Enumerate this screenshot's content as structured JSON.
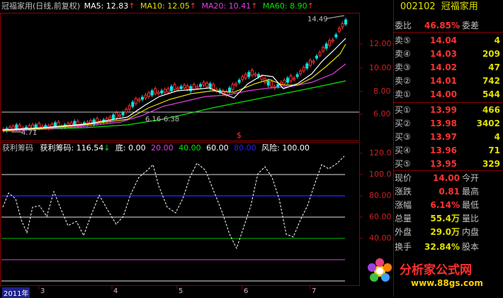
{
  "header": {
    "title": "冠福家用(日线,前复权)",
    "ma5": "MA5: 12.83",
    "ma10": "MA10: 12.05",
    "ma20": "MA20: 10.41",
    "ma60": "MA60: 8.90",
    "arrow": "↑"
  },
  "kline": {
    "yticks": [
      "12.00",
      "10.00",
      "8.00",
      "6.00"
    ],
    "max_label": "14.49",
    "min_label": "4.71",
    "range_label": "6.16-6.38",
    "dollar_mark": "$"
  },
  "indicator": {
    "name": "获利筹码",
    "value_label": "获利筹码: 116.54",
    "down_arrow": "↓",
    "levels": [
      "底: 0.00",
      "20.00",
      "40.00",
      "60.00",
      "80.00",
      "风险: 100.00"
    ],
    "yticks": [
      "120.0",
      "100.0",
      "80.00",
      "60.00",
      "40.00"
    ]
  },
  "xaxis": {
    "labels": [
      "2011年",
      "3",
      "4",
      "5",
      "6",
      "7"
    ]
  },
  "panel": {
    "code": "002102",
    "name": "冠福家用",
    "webi_label": "委比",
    "webi_value": "46.85%",
    "weicha_label": "委差",
    "sell": [
      {
        "label": "卖⑤",
        "price": "14.04",
        "vol": "4"
      },
      {
        "label": "卖④",
        "price": "14.03",
        "vol": "209"
      },
      {
        "label": "卖③",
        "price": "14.02",
        "vol": "47"
      },
      {
        "label": "卖②",
        "price": "14.01",
        "vol": "742"
      },
      {
        "label": "卖①",
        "price": "14.00",
        "vol": "544"
      }
    ],
    "buy": [
      {
        "label": "买①",
        "price": "13.99",
        "vol": "466"
      },
      {
        "label": "买②",
        "price": "13.98",
        "vol": "3402"
      },
      {
        "label": "买③",
        "price": "13.97",
        "vol": "4"
      },
      {
        "label": "买④",
        "price": "13.96",
        "vol": "71"
      },
      {
        "label": "买⑤",
        "price": "13.95",
        "vol": "329"
      }
    ],
    "quote": [
      {
        "l1": "现价",
        "v1": "14.00",
        "l2": "今开"
      },
      {
        "l1": "涨跌",
        "v1": "0.81",
        "l2": "最高"
      },
      {
        "l1": "涨幅",
        "v1": "6.14%",
        "l2": "最低"
      },
      {
        "l1": "总量",
        "v1": "55.4万",
        "l2": "量比"
      },
      {
        "l1": "外盘",
        "v1": "29.0万",
        "l2": "内盘"
      }
    ],
    "turnover": {
      "l1": "换手",
      "v1": "32.84%",
      "l2": "股本"
    }
  },
  "watermark": {
    "brand": "分析家公式网",
    "url": "www.88gs.com"
  },
  "colors": {
    "up": "#ff3232",
    "down": "#00e6e6",
    "ma5": "#ffffff",
    "ma10": "#e0e000",
    "ma20": "#e040e0",
    "ma60": "#00e600"
  }
}
